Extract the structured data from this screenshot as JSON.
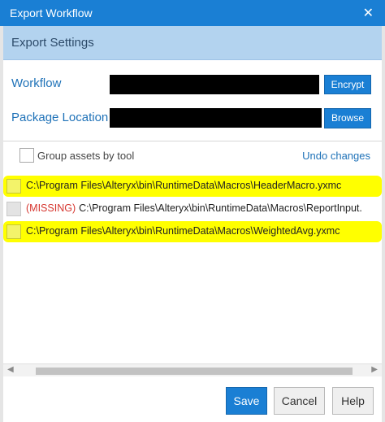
{
  "window": {
    "title": "Export Workflow",
    "close_glyph": "✕"
  },
  "section": {
    "title": "Export Settings"
  },
  "workflow": {
    "label": "Workflow",
    "button": "Encrypt"
  },
  "package": {
    "label": "Package Location",
    "button": "Browse"
  },
  "options": {
    "group_label": "Group assets by tool",
    "undo_label": "Undo changes"
  },
  "assets": [
    {
      "missing_label": "",
      "path": "C:\\Program Files\\Alteryx\\bin\\RuntimeData\\Macros\\HeaderMacro.yxmc",
      "highlighted": true,
      "disabled": false
    },
    {
      "missing_label": "(MISSING)",
      "path": "C:\\Program Files\\Alteryx\\bin\\RuntimeData\\Macros\\ReportInput.",
      "highlighted": false,
      "disabled": true
    },
    {
      "missing_label": "",
      "path": "C:\\Program Files\\Alteryx\\bin\\RuntimeData\\Macros\\WeightedAvg.yxmc",
      "highlighted": true,
      "disabled": false
    }
  ],
  "scrollbar": {
    "left_arrow": "◀",
    "right_arrow": "▶"
  },
  "footer": {
    "save_label": "Save",
    "cancel_label": "Cancel",
    "help_label": "Help"
  },
  "colors": {
    "accent": "#1a7fd4",
    "header_band": "#b3d3ef",
    "highlight": "#ffff00",
    "missing": "#d6362f"
  }
}
